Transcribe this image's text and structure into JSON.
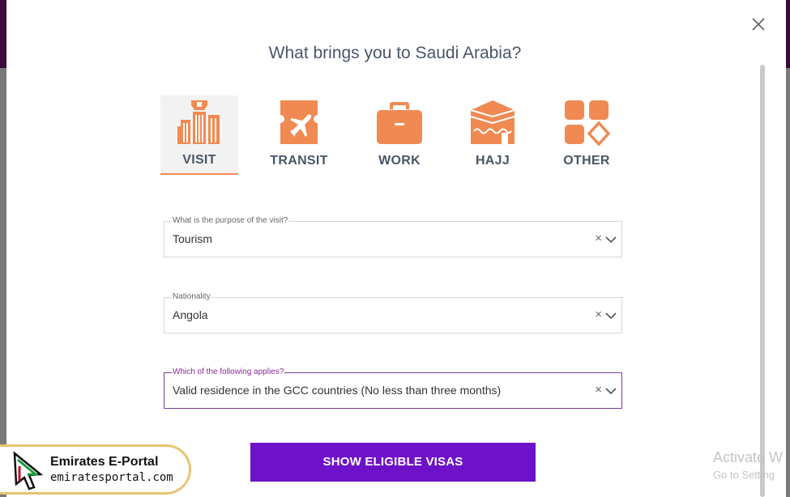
{
  "modal": {
    "title": "What brings you to Saudi Arabia?"
  },
  "categories": [
    {
      "label": "VISIT",
      "icon": "building-icon",
      "active": true
    },
    {
      "label": "TRANSIT",
      "icon": "plane-ticket-icon",
      "active": false
    },
    {
      "label": "WORK",
      "icon": "briefcase-icon",
      "active": false
    },
    {
      "label": "HAJJ",
      "icon": "kaaba-icon",
      "active": false
    },
    {
      "label": "OTHER",
      "icon": "grid-shapes-icon",
      "active": false
    }
  ],
  "form": {
    "purpose": {
      "label": "What is the purpose of the visit?",
      "value": "Tourism"
    },
    "nationality": {
      "label": "Nationality",
      "value": "Angola"
    },
    "applies": {
      "label": "Which of the following applies?",
      "value": "Valid residence in the GCC countries (No less than three months)"
    },
    "clear_glyph": "×"
  },
  "actions": {
    "show_label": "SHOW ELIGIBLE VISAS"
  },
  "system": {
    "activate_line1": "Activate W",
    "activate_line2": "Go to Setting"
  },
  "watermark": {
    "title": "Emirates E-Portal",
    "url": "emiratesportal.com"
  },
  "colors": {
    "accent_orange": "#f08a52",
    "button_purple": "#6e12c9",
    "focus_purple": "#7b3e8f"
  }
}
